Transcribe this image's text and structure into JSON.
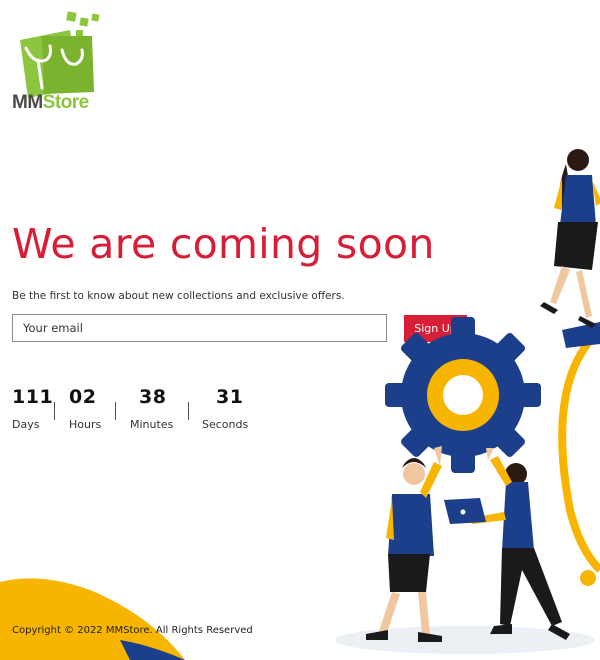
{
  "brand": {
    "name_part1": "MM",
    "name_part2": "Store",
    "colors": {
      "green": "#8cc63f",
      "dark": "#4a4a4a"
    }
  },
  "main": {
    "headline": "We are coming soon",
    "subtitle": "Be the first to know about new collections and exclusive offers.",
    "email_placeholder": "Your email",
    "signup_label": "Sign Up",
    "accent_color": "#d81e37"
  },
  "countdown": [
    {
      "value": "111",
      "label": "Days"
    },
    {
      "value": "02",
      "label": "Hours"
    },
    {
      "value": "38",
      "label": "Minutes"
    },
    {
      "value": "31",
      "label": "Seconds"
    }
  ],
  "footer": {
    "copyright": "Copyright © 2022 MMStore. All Rights Reserved"
  },
  "illustration": {
    "icon": "teamwork-gear-illustration",
    "colors": {
      "blue": "#1b3f8b",
      "yellow": "#f7b500"
    }
  }
}
